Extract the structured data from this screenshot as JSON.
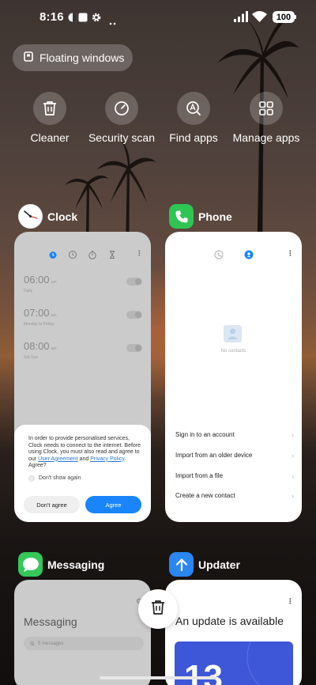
{
  "status_bar": {
    "time": "8:16",
    "battery": "100"
  },
  "floating_windows_label": "Floating windows",
  "quick_actions": [
    {
      "label": "Cleaner",
      "icon": "trash-icon"
    },
    {
      "label": "Security scan",
      "icon": "shield-check-icon"
    },
    {
      "label": "Find apps",
      "icon": "search-apps-icon"
    },
    {
      "label": "Manage apps",
      "icon": "grid-icon"
    }
  ],
  "apps": {
    "clock": {
      "name": "Clock",
      "alarms": [
        {
          "time": "06:00",
          "ampm": "am",
          "repeat": "Daily"
        },
        {
          "time": "07:00",
          "ampm": "am",
          "repeat": "Monday to Friday"
        },
        {
          "time": "08:00",
          "ampm": "am",
          "repeat": "Sat-Sun"
        }
      ],
      "dialog": {
        "text_before": "In order to provide personalised services, Clock needs to connect to the internet. Before using Clock, you must also read and agree to our ",
        "link1": "User Agreement",
        "and": " and ",
        "link2": "Privacy Policy",
        "text_after": ". Agree?",
        "dont_show": "Don't show again",
        "disagree": "Don't agree",
        "agree": "Agree"
      }
    },
    "phone": {
      "name": "Phone",
      "empty_text": "No contacts",
      "options": [
        "Sign in to an account",
        "Import from an older device",
        "Import from a file",
        "Create a new contact"
      ]
    },
    "messaging": {
      "name": "Messaging",
      "title": "Messaging",
      "search_placeholder": "5 messages"
    },
    "updater": {
      "name": "Updater",
      "title": "An update is available",
      "banner_text": "13"
    }
  },
  "colors": {
    "phone_green": "#2fc554",
    "messaging_green": "#35c75a",
    "updater_blue": "#2a86f0",
    "agree_blue": "#1a85f8"
  }
}
